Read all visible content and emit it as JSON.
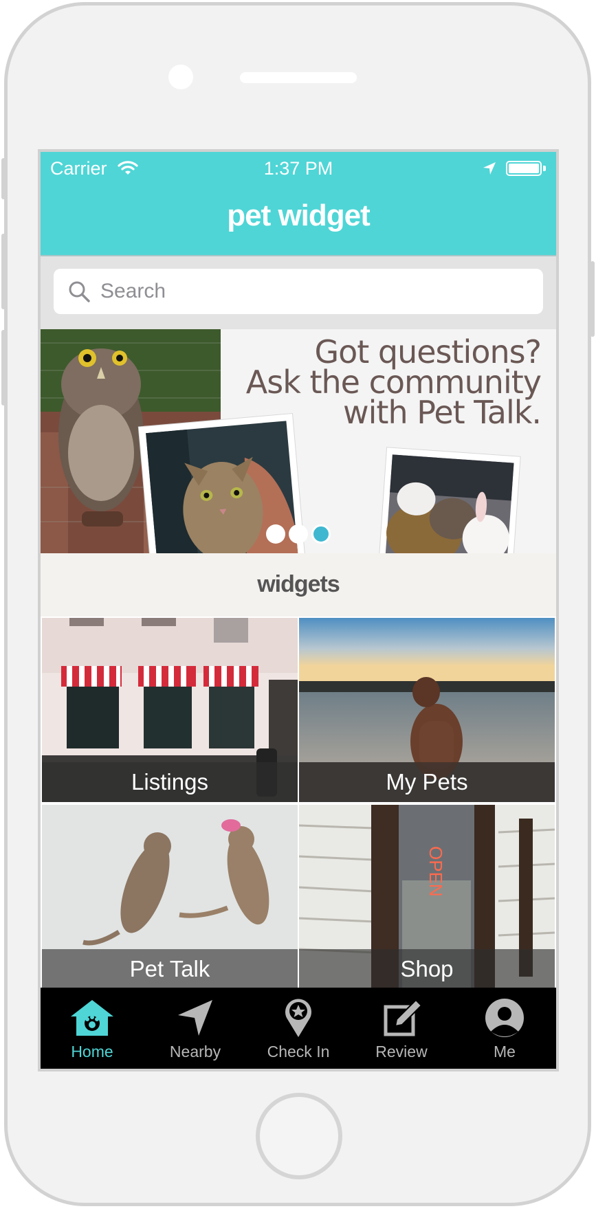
{
  "statusbar": {
    "carrier": "Carrier",
    "time": "1:37 PM"
  },
  "navbar": {
    "title": "pet widget"
  },
  "search": {
    "placeholder": "Search"
  },
  "banner": {
    "lines": [
      "Got questions?",
      "Ask the community",
      "with Pet Talk."
    ],
    "page_count": 3,
    "active_page": 3
  },
  "widgets": {
    "title": "widgets",
    "tiles": [
      {
        "label": "Listings"
      },
      {
        "label": "My Pets"
      },
      {
        "label": "Pet Talk"
      },
      {
        "label": "Shop"
      }
    ]
  },
  "tabbar": {
    "items": [
      {
        "label": "Home",
        "icon": "home-icon",
        "active": true
      },
      {
        "label": "Nearby",
        "icon": "location-arrow-icon"
      },
      {
        "label": "Check In",
        "icon": "map-pin-star-icon"
      },
      {
        "label": "Review",
        "icon": "edit-icon"
      },
      {
        "label": "Me",
        "icon": "user-icon"
      }
    ]
  },
  "colors": {
    "accent": "#4fd5d6",
    "pager_active": "#3fb7d0",
    "tabbar_bg": "#000000"
  }
}
